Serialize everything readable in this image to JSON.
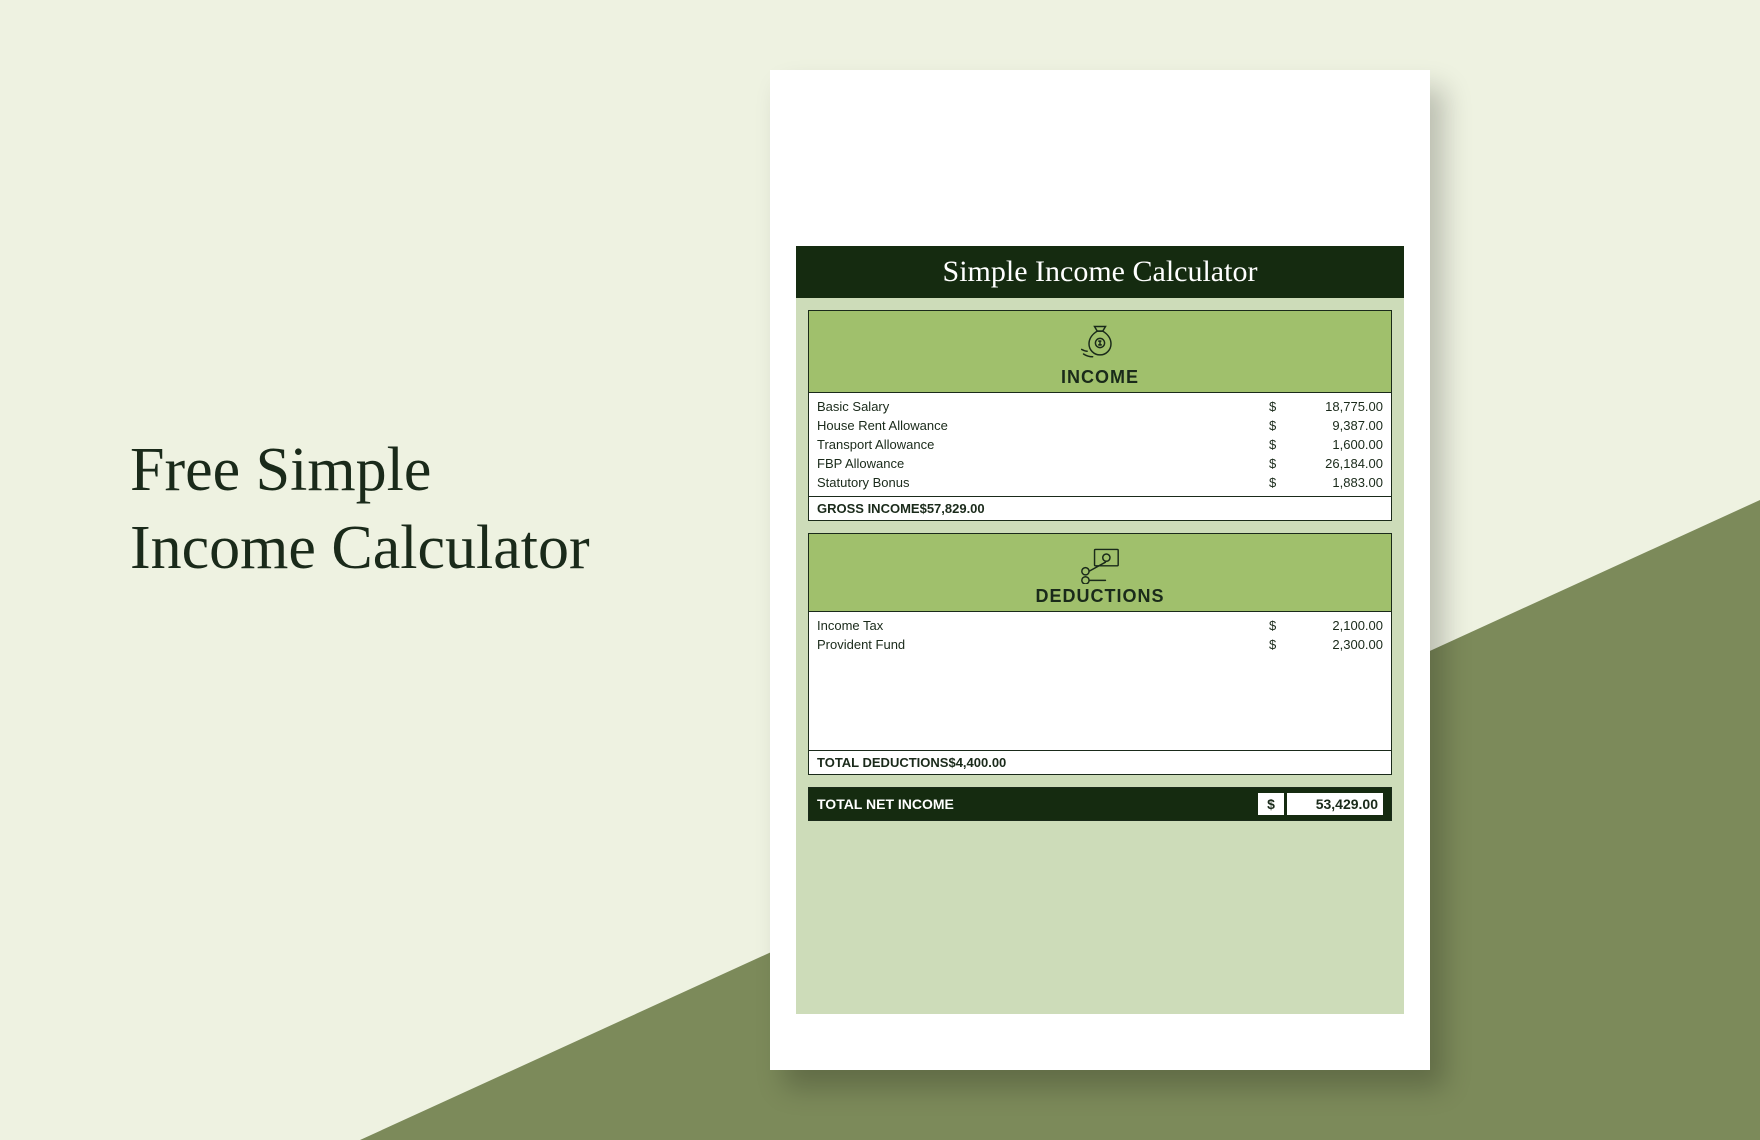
{
  "hero": {
    "line1": "Free Simple",
    "line2": "Income Calculator"
  },
  "sheet": {
    "title": "Simple Income Calculator"
  },
  "income": {
    "label": "INCOME",
    "items": [
      {
        "label": "Basic Salary",
        "currency": "$",
        "value": "18,775.00"
      },
      {
        "label": "House Rent Allowance",
        "currency": "$",
        "value": "9,387.00"
      },
      {
        "label": "Transport Allowance",
        "currency": "$",
        "value": "1,600.00"
      },
      {
        "label": "FBP Allowance",
        "currency": "$",
        "value": "26,184.00"
      },
      {
        "label": "Statutory Bonus",
        "currency": "$",
        "value": "1,883.00"
      }
    ],
    "total": {
      "label": "GROSS INCOME",
      "currency": "$",
      "value": "57,829.00"
    }
  },
  "deductions": {
    "label": "DEDUCTIONS",
    "items": [
      {
        "label": "Income Tax",
        "currency": "$",
        "value": "2,100.00"
      },
      {
        "label": "Provident Fund",
        "currency": "$",
        "value": "2,300.00"
      }
    ],
    "total": {
      "label": "TOTAL DEDUCTIONS",
      "currency": "$",
      "value": "4,400.00"
    }
  },
  "net": {
    "label": "TOTAL NET INCOME",
    "currency": "$",
    "value": "53,429.00"
  }
}
